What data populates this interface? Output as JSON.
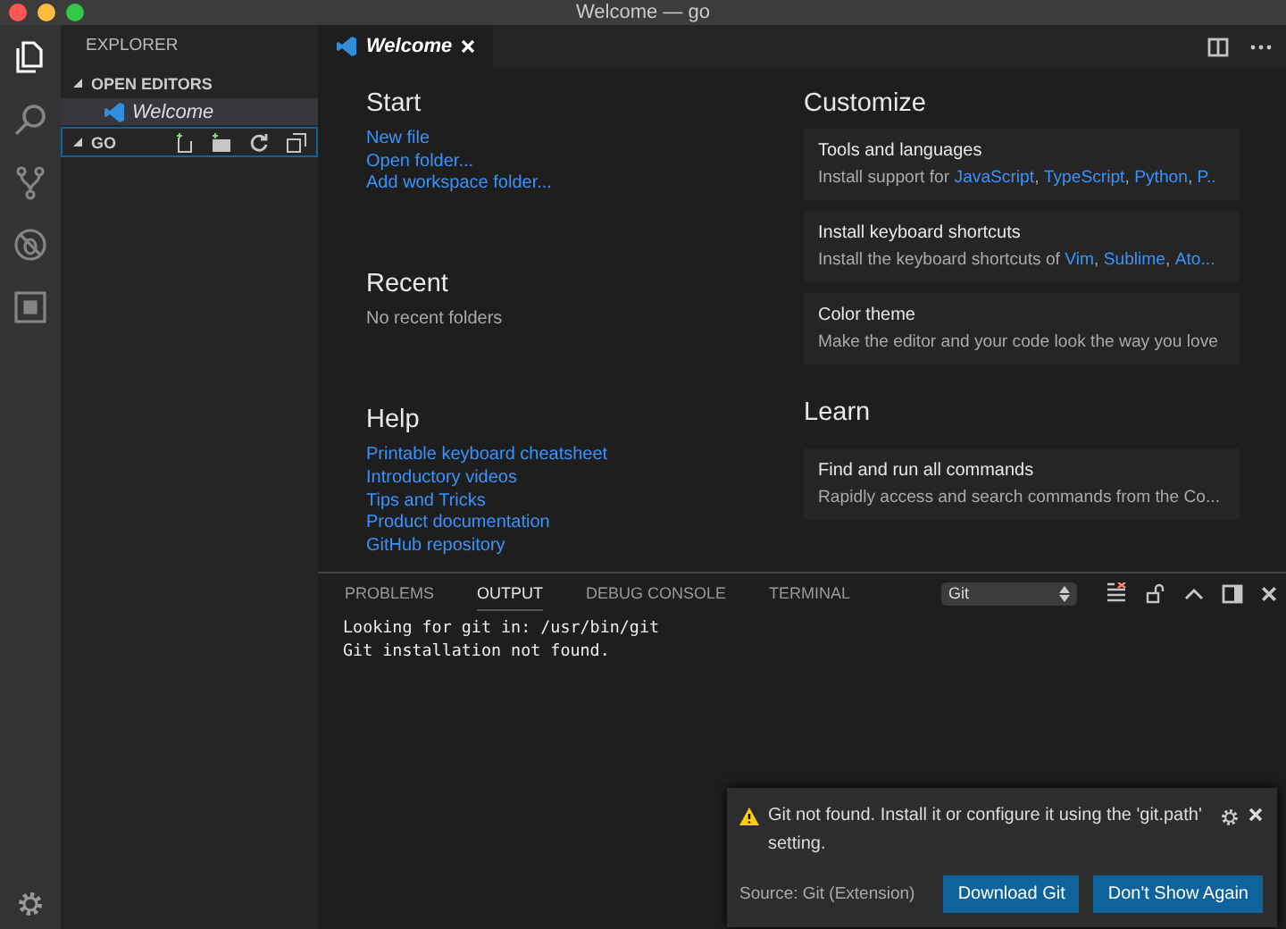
{
  "window": {
    "title": "Welcome — go"
  },
  "activity_bar": {
    "items": [
      {
        "kind": "files",
        "selected": true
      },
      {
        "kind": "search",
        "selected": false
      },
      {
        "kind": "git",
        "selected": false
      },
      {
        "kind": "debug",
        "selected": false
      },
      {
        "kind": "extensions",
        "selected": false
      }
    ]
  },
  "sidebar": {
    "title": "EXPLORER",
    "sections": [
      {
        "label": "OPEN EDITORS",
        "expanded": true,
        "focused": false,
        "items": [
          {
            "label": "Welcome",
            "selected": true
          }
        ]
      },
      {
        "label": "GO",
        "expanded": true,
        "focused": true
      }
    ]
  },
  "editor": {
    "tabs": [
      {
        "label": "Welcome",
        "selected": true
      }
    ],
    "start": {
      "heading": "Start",
      "links": [
        "New file",
        "Open folder...",
        "Add workspace folder..."
      ]
    },
    "recent": {
      "heading": "Recent",
      "text": "No recent folders"
    },
    "help": {
      "heading": "Help",
      "links": [
        "Printable keyboard cheatsheet",
        "Introductory videos",
        "Tips and Tricks",
        "Product documentation",
        "GitHub repository"
      ]
    },
    "customize": {
      "heading": "Customize",
      "cards": [
        {
          "title": "Tools and languages",
          "lead": "Install support for ",
          "links": [
            "JavaScript",
            "TypeScript",
            "Python",
            "P.."
          ],
          "separator": ", "
        },
        {
          "title": "Install keyboard shortcuts",
          "lead": "Install the keyboard shortcuts of ",
          "links": [
            "Vim",
            "Sublime",
            "Ato..."
          ],
          "separator": ", "
        },
        {
          "title": "Color theme",
          "lead": "Make the editor and your code look the way you love"
        }
      ]
    },
    "learn": {
      "heading": "Learn",
      "cards": [
        {
          "title": "Find and run all commands",
          "lead": "Rapidly access and search commands from the Co..."
        }
      ]
    }
  },
  "panel": {
    "tabs": [
      {
        "label": "PROBLEMS",
        "selected": false
      },
      {
        "label": "OUTPUT",
        "selected": true
      },
      {
        "label": "DEBUG CONSOLE",
        "selected": false
      },
      {
        "label": "TERMINAL",
        "selected": false
      }
    ],
    "channel": "Git",
    "lines": [
      "Looking for git in: /usr/bin/git",
      "Git installation not found."
    ]
  },
  "notification": {
    "message": "Git not found. Install it or configure it using the 'git.path' setting.",
    "source": "Source: Git (Extension)",
    "buttons": [
      "Download Git",
      "Don't Show Again"
    ]
  }
}
